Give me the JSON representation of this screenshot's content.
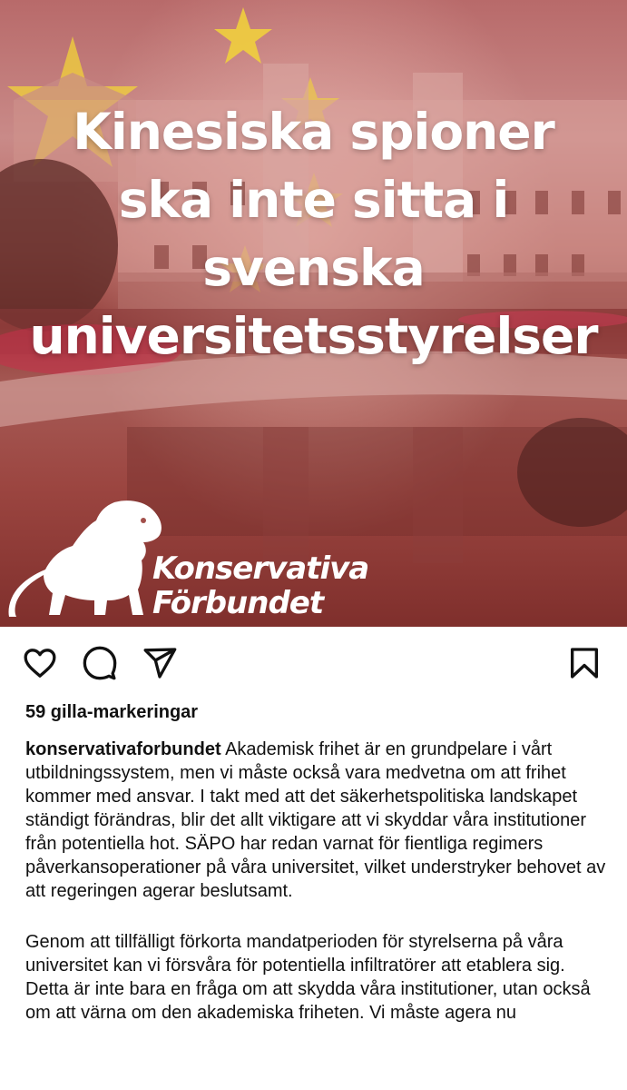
{
  "post": {
    "headline_lines": [
      "Kinesiska spioner",
      "ska inte sitta i",
      "svenska",
      "universitetsstyrelser"
    ],
    "brand_line1": "Konservativa",
    "brand_line2": "Förbundet",
    "icons": [
      "heart-icon",
      "comment-icon",
      "share-icon",
      "bookmark-icon",
      "lion-logo-icon",
      "star-icon"
    ],
    "colors": {
      "overlay": "#b4645f",
      "star": "#f2d33a",
      "text": "#111111"
    }
  },
  "likes_label": "59 gilla-markeringar",
  "caption": {
    "username": "konservativaforbundet",
    "paragraph1": "Akademisk frihet är en grundpelare i vårt utbildningssystem, men vi måste också vara medvetna om att frihet kommer med ansvar. I takt med att det säkerhetspolitiska landskapet ständigt förändras, blir det allt viktigare att vi skyddar våra institutioner från potentiella hot. SÄPO har redan varnat för fientliga regimers påverkansoperationer på våra universitet, vilket understryker behovet av att regeringen agerar beslutsamt.",
    "paragraph2": "Genom att tillfälligt förkorta mandatperioden för styrelserna på våra universitet kan vi försvåra för potentiella infiltratörer att etablera sig. Detta är inte bara en fråga om att skydda våra institutioner, utan också om att värna om den akademiska friheten. Vi måste agera nu"
  }
}
